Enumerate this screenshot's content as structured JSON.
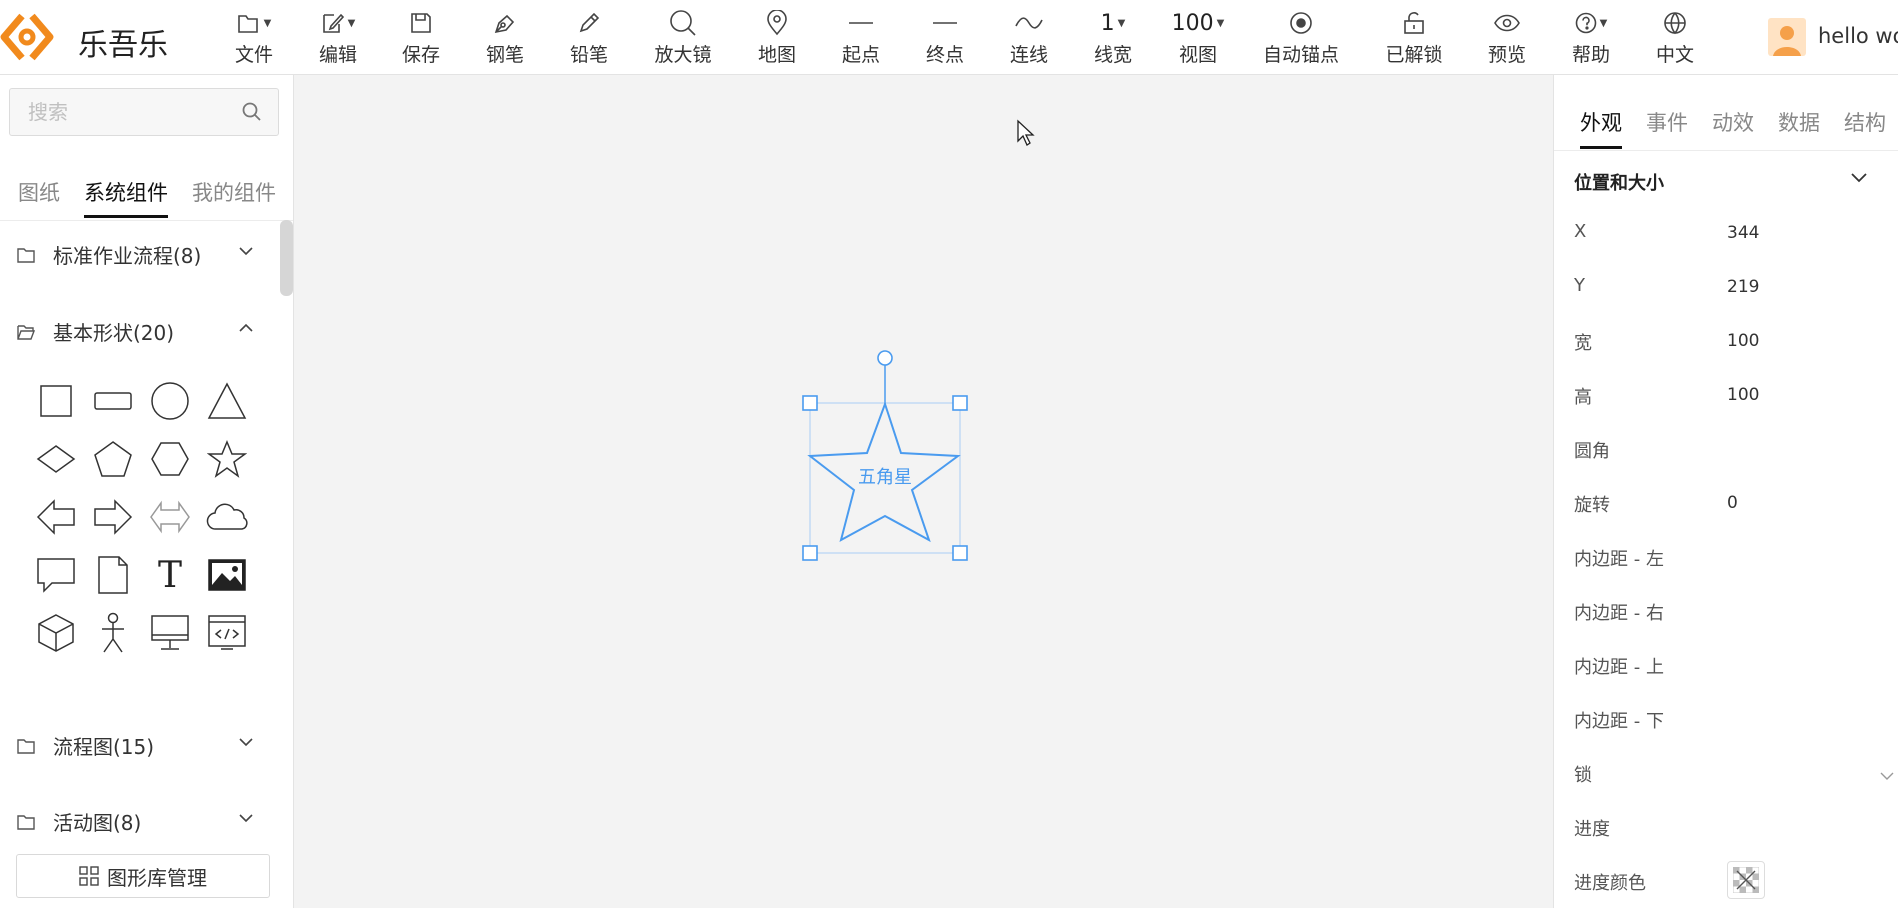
{
  "app": {
    "brand": "乐吾乐",
    "brand_color": "#f18a1d",
    "accent_color": "#4a9bef"
  },
  "toolbar": {
    "items": [
      {
        "label": "文件",
        "icon": "file-icon",
        "dropdown": true
      },
      {
        "label": "编辑",
        "icon": "edit-icon",
        "dropdown": true
      },
      {
        "label": "保存",
        "icon": "save-icon"
      },
      {
        "label": "钢笔",
        "icon": "pen-icon"
      },
      {
        "label": "铅笔",
        "icon": "pencil-icon"
      },
      {
        "label": "放大镜",
        "icon": "magnifier-icon"
      },
      {
        "label": "地图",
        "icon": "map-pin-icon"
      },
      {
        "label": "起点",
        "icon": "line-start-icon"
      },
      {
        "label": "终点",
        "icon": "line-end-icon"
      },
      {
        "label": "连线",
        "icon": "curve-icon"
      },
      {
        "label": "线宽",
        "value": "1",
        "dropdown": true
      },
      {
        "label": "视图",
        "value": "100",
        "dropdown": true
      },
      {
        "label": "自动锚点",
        "icon": "anchor-icon"
      },
      {
        "label": "已解锁",
        "icon": "unlock-icon"
      },
      {
        "label": "预览",
        "icon": "eye-icon"
      },
      {
        "label": "帮助",
        "icon": "help-icon",
        "dropdown": true
      },
      {
        "label": "中文",
        "icon": "globe-icon"
      }
    ]
  },
  "user": {
    "name": "hello wo"
  },
  "left_panel": {
    "search_placeholder": "搜索",
    "tabs": [
      "图纸",
      "系统组件",
      "我的组件"
    ],
    "active_tab": "系统组件",
    "categories": [
      {
        "name": "标准作业流程(8)",
        "expanded": false
      },
      {
        "name": "基本形状(20)",
        "expanded": true
      },
      {
        "name": "流程图(15)",
        "expanded": false
      },
      {
        "name": "活动图(8)",
        "expanded": false
      }
    ],
    "shapes": [
      "square",
      "rectangle",
      "circle",
      "triangle",
      "diamond",
      "pentagon",
      "hexagon",
      "star",
      "left-arrow",
      "right-arrow",
      "two-way-arrow",
      "cloud",
      "message",
      "file",
      "text",
      "image",
      "cube",
      "people",
      "computer",
      "iframe"
    ],
    "text_shape_glyph": "T",
    "library_button": "图形库管理"
  },
  "canvas": {
    "selected_shape_text": "五角星"
  },
  "right_panel": {
    "tabs": [
      "外观",
      "事件",
      "动效",
      "数据",
      "结构"
    ],
    "active_tab": "外观",
    "section_title": "位置和大小",
    "props": [
      {
        "label": "X",
        "value": "344"
      },
      {
        "label": "Y",
        "value": "219"
      },
      {
        "label": "宽",
        "value": "100"
      },
      {
        "label": "高",
        "value": "100"
      },
      {
        "label": "圆角",
        "value": ""
      },
      {
        "label": "旋转",
        "value": "0"
      },
      {
        "label": "内边距 - 左",
        "value": ""
      },
      {
        "label": "内边距 - 右",
        "value": ""
      },
      {
        "label": "内边距 - 上",
        "value": ""
      },
      {
        "label": "内边距 - 下",
        "value": ""
      },
      {
        "label": "锁",
        "value": ""
      },
      {
        "label": "进度",
        "value": ""
      },
      {
        "label": "进度颜色",
        "value": ""
      }
    ]
  }
}
